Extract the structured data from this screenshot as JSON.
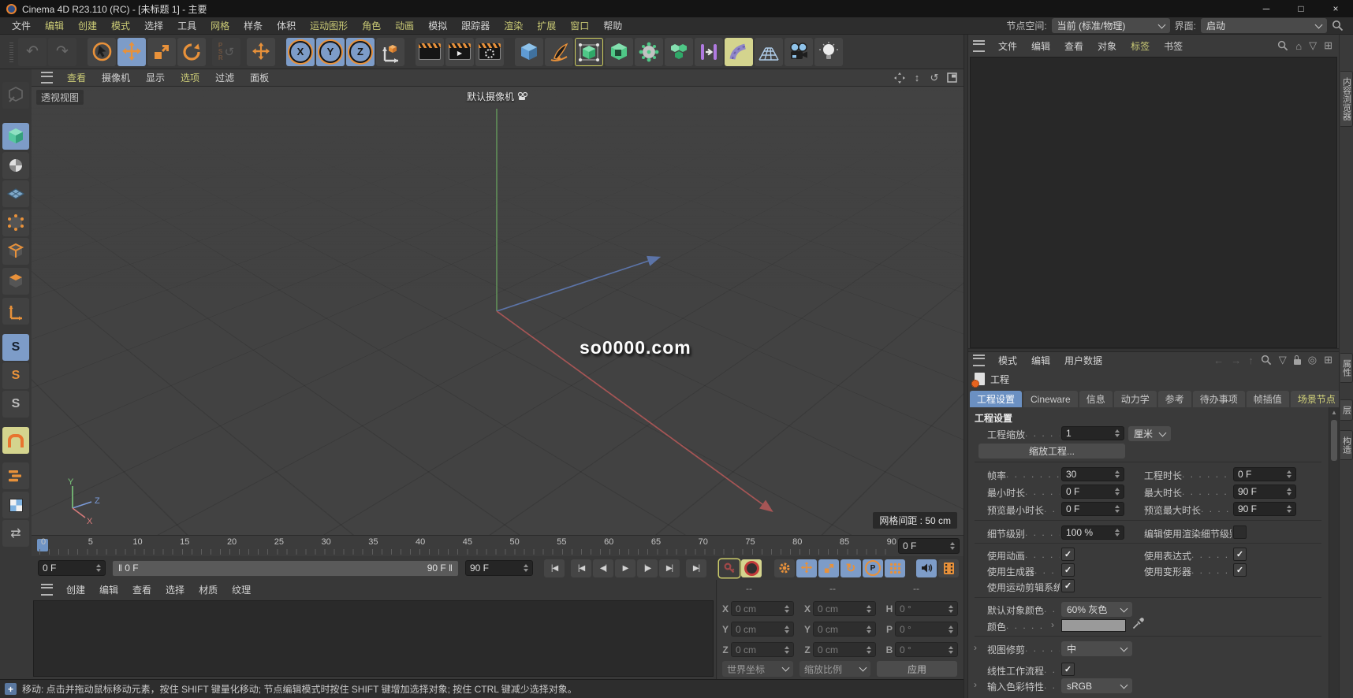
{
  "titlebar": {
    "title": "Cinema 4D R23.110 (RC) - [未标题 1] - 主要",
    "minimize_glyph": "─",
    "maximize_glyph": "□",
    "close_glyph": "×"
  },
  "menubar": {
    "items": [
      {
        "label": "文件",
        "accent": false
      },
      {
        "label": "编辑",
        "accent": true
      },
      {
        "label": "创建",
        "accent": true
      },
      {
        "label": "模式",
        "accent": true
      },
      {
        "label": "选择",
        "accent": false
      },
      {
        "label": "工具",
        "accent": false
      },
      {
        "label": "网格",
        "accent": true
      },
      {
        "label": "样条",
        "accent": false
      },
      {
        "label": "体积",
        "accent": false
      },
      {
        "label": "运动图形",
        "accent": true
      },
      {
        "label": "角色",
        "accent": true
      },
      {
        "label": "动画",
        "accent": true
      },
      {
        "label": "模拟",
        "accent": false
      },
      {
        "label": "跟踪器",
        "accent": false
      },
      {
        "label": "渲染",
        "accent": true
      },
      {
        "label": "扩展",
        "accent": true
      },
      {
        "label": "窗口",
        "accent": true
      },
      {
        "label": "帮助",
        "accent": false
      }
    ],
    "node_space_label": "节点空间:",
    "node_space_value": "当前 (标准/物理)",
    "interface_label": "界面:",
    "interface_value": "启动"
  },
  "toolbar": {
    "axis_x": "X",
    "axis_y": "Y",
    "axis_z": "Z",
    "psr_p": "P",
    "psr_s": "S",
    "psr_r": "R",
    "tools": [
      "undo",
      "redo",
      "live-selection",
      "move",
      "scale",
      "rotate",
      "reset-psr",
      "last-tool-move",
      "lock-x-axis",
      "lock-y-axis",
      "lock-z-axis",
      "coordinate-system",
      "render-view",
      "render-to-picture-viewer",
      "edit-render-settings",
      "cube-primitive",
      "spline-pen",
      "subdivision-surface",
      "extrude",
      "volume-builder",
      "cloner",
      "field",
      "bend",
      "floor",
      "camera",
      "light"
    ]
  },
  "leftbar": {
    "solo_letter": "S",
    "mirror_glyph": "⇄",
    "tools": [
      "make-editable",
      "model-mode",
      "texture-mode",
      "workplane-mode",
      "points-mode",
      "edges-mode",
      "polygons-mode",
      "enable-axis",
      "viewport-solo-off",
      "viewport-solo-single",
      "viewport-solo-hierarchy",
      "enable-snap",
      "enable-quantize",
      "modeling-settings",
      "mirror-tool"
    ]
  },
  "viewport": {
    "menu": [
      "查看",
      "摄像机",
      "显示",
      "选项",
      "过滤",
      "面板"
    ],
    "view_label": "透视视图",
    "camera_label": "默认摄像机",
    "watermark": "so0000.com",
    "grid_spacing": "网格间距 : 50 cm",
    "gizmo": {
      "x": "X",
      "y": "Y",
      "z": "Z"
    }
  },
  "timeline": {
    "ticks": [
      "0",
      "5",
      "10",
      "15",
      "20",
      "25",
      "30",
      "35",
      "40",
      "45",
      "50",
      "55",
      "60",
      "65",
      "70",
      "75",
      "80",
      "85",
      "90"
    ],
    "current_frame": "0 F",
    "start_field": "0 F",
    "loop_start": "0 F",
    "loop_end": "90 F",
    "end_field": "90 F"
  },
  "transport": {
    "go_start": "|◀",
    "prev_key": "|◀",
    "prev_frame": "◀|",
    "play": "▶",
    "next_frame": "|▶",
    "next_key": "▶|",
    "go_end": "▶|",
    "parameter_letter": "P",
    "rotate_glyph": "↻"
  },
  "material_manager": {
    "menu": [
      "创建",
      "编辑",
      "查看",
      "选择",
      "材质",
      "纹理"
    ]
  },
  "coordinates": {
    "headers": [
      "--",
      "--",
      "--"
    ],
    "col1": {
      "rows": [
        [
          "X",
          "0 cm"
        ],
        [
          "Y",
          "0 cm"
        ],
        [
          "Z",
          "0 cm"
        ]
      ]
    },
    "col2": {
      "rows": [
        [
          "X",
          "0 cm"
        ],
        [
          "Y",
          "0 cm"
        ],
        [
          "Z",
          "0 cm"
        ]
      ]
    },
    "col3": {
      "rows": [
        [
          "H",
          "0 °"
        ],
        [
          "P",
          "0 °"
        ],
        [
          "B",
          "0 °"
        ]
      ]
    },
    "system": "世界坐标",
    "mode": "缩放比例",
    "apply_label": "应用"
  },
  "status_bar": {
    "text": "移动: 点击并拖动鼠标移动元素，按住 SHIFT 键量化移动; 节点编辑模式时按住 SHIFT 键增加选择对象; 按住 CTRL 键减少选择对象。"
  },
  "object_manager": {
    "menu": [
      "文件",
      "编辑",
      "查看",
      "对象",
      "标签",
      "书签"
    ]
  },
  "attribute_manager": {
    "menu": [
      "模式",
      "编辑",
      "用户数据"
    ],
    "title": "工程",
    "tabs": [
      "工程设置",
      "Cineware",
      "信息",
      "动力学",
      "参考",
      "待办事项",
      "帧插值",
      "场景节点"
    ],
    "section": "工程设置",
    "project_scale_label": "工程缩放",
    "project_scale_value": "1",
    "project_scale_unit": "厘米",
    "scale_project_button": "缩放工程...",
    "fps_label": "帧率",
    "fps_value": "30",
    "project_time_label": "工程时长",
    "project_time_value": "0 F",
    "min_time_label": "最小时长",
    "min_time_value": "0 F",
    "max_time_label": "最大时长",
    "max_time_value": "90 F",
    "preview_min_label": "预览最小时长",
    "preview_min_value": "0 F",
    "preview_max_label": "预览最大时长",
    "preview_max_value": "90 F",
    "lod_label": "细节级别",
    "lod_value": "100 %",
    "render_lod_label": "编辑使用渲染细节级别",
    "use_animation_label": "使用动画",
    "use_expressions_label": "使用表达式",
    "use_generators_label": "使用生成器",
    "use_deformers_label": "使用变形器",
    "use_motion_label": "使用运动剪辑系统",
    "default_color_label": "默认对象颜色",
    "default_color_value": "60% 灰色",
    "color_label": "颜色",
    "color_swatch": "#9a9a9a",
    "view_clipping_label": "视图修剪",
    "view_clipping_value": "中",
    "linear_workflow_label": "线性工作流程",
    "input_profile_label": "输入色彩特性",
    "input_profile_value": "sRGB",
    "check_glyph": "✓",
    "expander_glyph": "›",
    "reveal_glyph": "›"
  },
  "right_tabs": {
    "top": "内容浏览器",
    "attrs": "属性",
    "layers": "层",
    "structure": "构造"
  },
  "icons": {
    "undo": "↶",
    "redo": "↷",
    "home": "⌂",
    "filter": "▽",
    "add": "⊞",
    "back": "←",
    "forward": "→",
    "up": "↑",
    "target": "◎",
    "rotate_view": "↺",
    "dolly": "↕",
    "scroll_up": "▲",
    "status_tool": "+"
  }
}
